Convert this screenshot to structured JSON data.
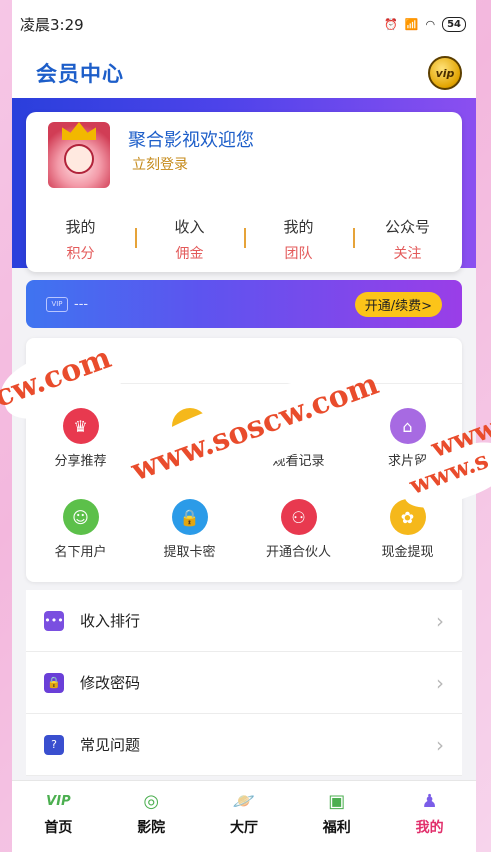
{
  "status_bar": {
    "time": "凌晨3:29",
    "battery": "54"
  },
  "header": {
    "title": "会员中心",
    "vip_badge": "vip"
  },
  "profile": {
    "welcome": "聚合影视欢迎您",
    "login_link": "立刻登录",
    "stats": [
      {
        "top": "我的",
        "bottom": "积分"
      },
      {
        "top": "收入",
        "bottom": "佣金"
      },
      {
        "top": "我的",
        "bottom": "团队"
      },
      {
        "top": "公众号",
        "bottom": "关注"
      }
    ]
  },
  "vip_bar": {
    "card_icon_text": "VIP",
    "status": "---",
    "renew_label": "开通/续费>"
  },
  "tools": [
    {
      "label": "分享推荐",
      "icon": "crown-icon",
      "color": "#e8394f",
      "glyph": "♛"
    },
    {
      "label": "",
      "icon": "coins-icon",
      "color": "#f5b81b",
      "glyph": "≡"
    },
    {
      "label": "观看记录",
      "icon": "play-icon",
      "color": "#2b9be8",
      "glyph": "▶"
    },
    {
      "label": "求片留",
      "icon": "shop-icon",
      "color": "#a76ae2",
      "glyph": "⌂"
    },
    {
      "label": "名下用户",
      "icon": "user-card-icon",
      "color": "#5cc04a",
      "glyph": "☺"
    },
    {
      "label": "提取卡密",
      "icon": "lock-icon",
      "color": "#2b9be8",
      "glyph": "🔒"
    },
    {
      "label": "开通合伙人",
      "icon": "network-icon",
      "color": "#e8394f",
      "glyph": "⚇"
    },
    {
      "label": "现金提现",
      "icon": "gear-icon",
      "color": "#f5b81b",
      "glyph": "✿"
    }
  ],
  "menu": [
    {
      "label": "收入排行",
      "icon": "chat-icon",
      "color": "#7a4fe0",
      "glyph": "•••"
    },
    {
      "label": "修改密码",
      "icon": "padlock-icon",
      "color": "#6a3fd8",
      "glyph": "🔒"
    },
    {
      "label": "常见问题",
      "icon": "question-icon",
      "color": "#3a4fcf",
      "glyph": "?"
    }
  ],
  "tabs": [
    {
      "label": "首页",
      "icon": "vip-icon",
      "glyph": "VIP",
      "color": "#4caf50"
    },
    {
      "label": "影院",
      "icon": "film-reel-icon",
      "glyph": "◎",
      "color": "#4caf50"
    },
    {
      "label": "大厅",
      "icon": "planet-icon",
      "glyph": "🪐",
      "color": "#4caf50"
    },
    {
      "label": "福利",
      "icon": "gift-icon",
      "glyph": "▣",
      "color": "#4caf50"
    },
    {
      "label": "我的",
      "icon": "person-icon",
      "glyph": "♟",
      "color": "#7b5de8"
    }
  ],
  "watermark": [
    "www.soscw.com",
    "cw.com",
    "www.s",
    "www.s"
  ]
}
